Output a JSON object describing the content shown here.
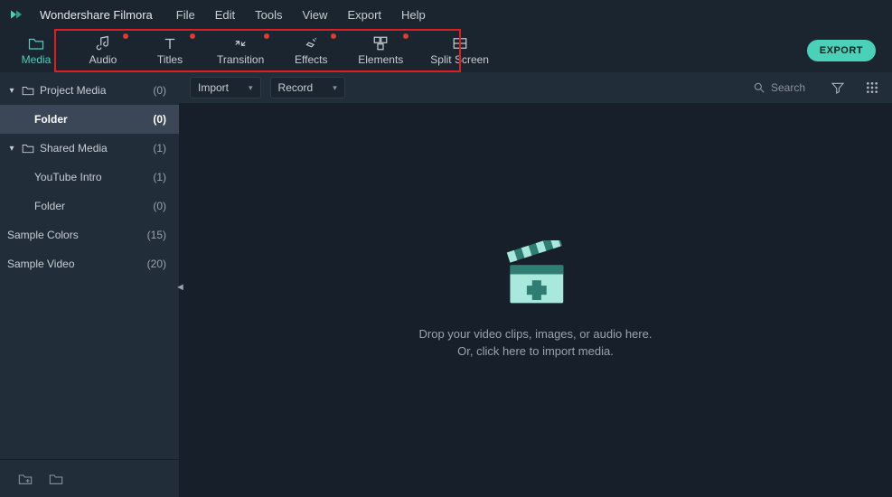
{
  "app": {
    "name": "Wondershare Filmora"
  },
  "menu": [
    "File",
    "Edit",
    "Tools",
    "View",
    "Export",
    "Help"
  ],
  "tabs": [
    {
      "key": "media",
      "label": "Media",
      "dot": false,
      "active": true
    },
    {
      "key": "audio",
      "label": "Audio",
      "dot": true,
      "active": false
    },
    {
      "key": "titles",
      "label": "Titles",
      "dot": true,
      "active": false
    },
    {
      "key": "transition",
      "label": "Transition",
      "dot": true,
      "active": false
    },
    {
      "key": "effects",
      "label": "Effects",
      "dot": true,
      "active": false
    },
    {
      "key": "elements",
      "label": "Elements",
      "dot": true,
      "active": false
    },
    {
      "key": "splitscreen",
      "label": "Split Screen",
      "dot": false,
      "active": false
    }
  ],
  "export_label": "EXPORT",
  "sidebar": {
    "items": [
      {
        "label": "Project Media",
        "count": "(0)",
        "level": 1,
        "expandable": true,
        "folderIcon": true,
        "selected": false
      },
      {
        "label": "Folder",
        "count": "(0)",
        "level": 2,
        "expandable": false,
        "folderIcon": false,
        "selected": true
      },
      {
        "label": "Shared Media",
        "count": "(1)",
        "level": 1,
        "expandable": true,
        "folderIcon": true,
        "selected": false
      },
      {
        "label": "YouTube Intro",
        "count": "(1)",
        "level": 2,
        "expandable": false,
        "folderIcon": false,
        "selected": false
      },
      {
        "label": "Folder",
        "count": "(0)",
        "level": 2,
        "expandable": false,
        "folderIcon": false,
        "selected": false
      },
      {
        "label": "Sample Colors",
        "count": "(15)",
        "level": 0,
        "expandable": false,
        "folderIcon": false,
        "selected": false
      },
      {
        "label": "Sample Video",
        "count": "(20)",
        "level": 0,
        "expandable": false,
        "folderIcon": false,
        "selected": false
      }
    ]
  },
  "toolbar": {
    "import_label": "Import",
    "record_label": "Record",
    "search_placeholder": "Search"
  },
  "drop": {
    "line1": "Drop your video clips, images, or audio here.",
    "line2": "Or, click here to import media."
  }
}
